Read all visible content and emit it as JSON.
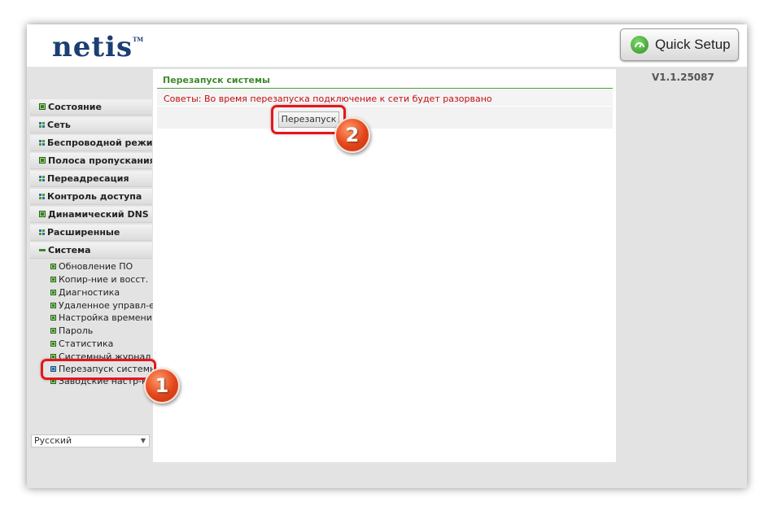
{
  "brand": {
    "logo": "netis",
    "trademark": "TM",
    "quick_setup_label": "Quick Setup"
  },
  "version": "V1.1.25087",
  "sidebar": {
    "items": [
      {
        "label": "Состояние",
        "icon": "green-box-icon"
      },
      {
        "label": "Сеть",
        "icon": "quad-icon"
      },
      {
        "label": "Беспроводной режим",
        "icon": "quad-icon"
      },
      {
        "label": "Полоса пропускания",
        "icon": "green-box-icon"
      },
      {
        "label": "Переадресация",
        "icon": "quad-icon"
      },
      {
        "label": "Контроль доступа",
        "icon": "quad-icon"
      },
      {
        "label": "Динамический DNS",
        "icon": "green-box-icon"
      },
      {
        "label": "Расширенные",
        "icon": "quad-icon"
      },
      {
        "label": "Система",
        "icon": "minus-icon"
      }
    ],
    "system_subitems": [
      {
        "label": "Обновление ПО"
      },
      {
        "label": "Копир-ние и восст."
      },
      {
        "label": "Диагностика"
      },
      {
        "label": "Удаленное управл-е"
      },
      {
        "label": "Настройка времени"
      },
      {
        "label": "Пароль"
      },
      {
        "label": "Статистика"
      },
      {
        "label": "Системный журнал"
      },
      {
        "label": "Перезапуск системы"
      },
      {
        "label": "Заводские настр-ки"
      }
    ],
    "language": "Русский"
  },
  "content": {
    "title": "Перезапуск системы",
    "tip": "Советы: Во время перезапуска подключение к сети будет разорвано",
    "reboot_button": "Перезапуск"
  },
  "annotations": {
    "badge1": "1",
    "badge2": "2",
    "highlight_color": "#e8141b",
    "badge_color": "#e2451a"
  },
  "colors": {
    "accent_green": "#3f8a2e",
    "tip_red": "#c01010",
    "logo_blue": "#1b3f73"
  }
}
